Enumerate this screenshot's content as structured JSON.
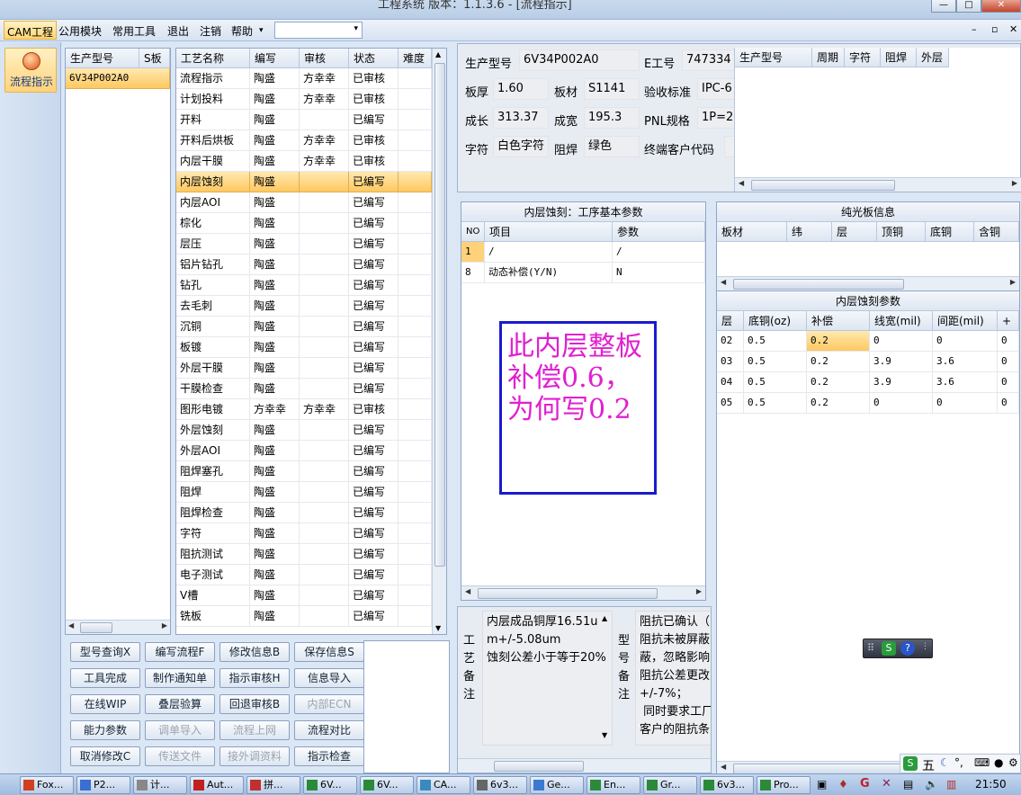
{
  "window": {
    "title": "工程系统   版本：1.1.3.6 - [流程指示]"
  },
  "menu": {
    "items": [
      "CAM工程",
      "公用模块",
      "常用工具",
      "退出",
      "注销",
      "帮助"
    ],
    "combo_value": ""
  },
  "left_nav": {
    "label": "流程指示"
  },
  "model_list": {
    "headers": [
      "生产型号",
      "S板"
    ],
    "rows": [
      [
        "6V34P002A0",
        ""
      ]
    ]
  },
  "process_table": {
    "headers": [
      "工艺名称",
      "编写",
      "审核",
      "状态",
      "难度"
    ],
    "rows": [
      [
        "流程指示",
        "陶盛",
        "方幸幸",
        "已审核",
        ""
      ],
      [
        "计划投料",
        "陶盛",
        "方幸幸",
        "已审核",
        ""
      ],
      [
        "开料",
        "陶盛",
        "",
        "已编写",
        ""
      ],
      [
        "开料后烘板",
        "陶盛",
        "方幸幸",
        "已审核",
        ""
      ],
      [
        "内层干膜",
        "陶盛",
        "方幸幸",
        "已审核",
        ""
      ],
      [
        "内层蚀刻",
        "陶盛",
        "",
        "已编写",
        ""
      ],
      [
        "内层AOI",
        "陶盛",
        "",
        "已编写",
        ""
      ],
      [
        "棕化",
        "陶盛",
        "",
        "已编写",
        ""
      ],
      [
        "层压",
        "陶盛",
        "",
        "已编写",
        ""
      ],
      [
        "铝片钻孔",
        "陶盛",
        "",
        "已编写",
        ""
      ],
      [
        "钻孔",
        "陶盛",
        "",
        "已编写",
        ""
      ],
      [
        "去毛刺",
        "陶盛",
        "",
        "已编写",
        ""
      ],
      [
        "沉铜",
        "陶盛",
        "",
        "已编写",
        ""
      ],
      [
        "板镀",
        "陶盛",
        "",
        "已编写",
        ""
      ],
      [
        "外层干膜",
        "陶盛",
        "",
        "已编写",
        ""
      ],
      [
        "干膜检查",
        "陶盛",
        "",
        "已编写",
        ""
      ],
      [
        "图形电镀",
        "方幸幸",
        "方幸幸",
        "已审核",
        ""
      ],
      [
        "外层蚀刻",
        "陶盛",
        "",
        "已编写",
        ""
      ],
      [
        "外层AOI",
        "陶盛",
        "",
        "已编写",
        ""
      ],
      [
        "阻焊塞孔",
        "陶盛",
        "",
        "已编写",
        ""
      ],
      [
        "阻焊",
        "陶盛",
        "",
        "已编写",
        ""
      ],
      [
        "阻焊检查",
        "陶盛",
        "",
        "已编写",
        ""
      ],
      [
        "字符",
        "陶盛",
        "",
        "已编写",
        ""
      ],
      [
        "阻抗测试",
        "陶盛",
        "",
        "已编写",
        ""
      ],
      [
        "电子测试",
        "陶盛",
        "",
        "已编写",
        ""
      ],
      [
        "V槽",
        "陶盛",
        "",
        "已编写",
        ""
      ],
      [
        "铣板",
        "陶盛",
        "",
        "已编写",
        ""
      ]
    ],
    "selected_index": 5
  },
  "buttons": [
    [
      "型号查询X",
      "编写流程F",
      "修改信息B",
      "保存信息S"
    ],
    [
      "工具完成",
      "制作通知单",
      "指示审核H",
      "信息导入"
    ],
    [
      "在线WIP",
      "叠层验算",
      "回退审核B",
      "内部ECN"
    ],
    [
      "能力参数",
      "调单导入",
      "流程上网",
      "流程对比"
    ],
    [
      "取消修改C",
      "传送文件",
      "接外调资料",
      "指示检查"
    ]
  ],
  "disabled_buttons": [
    "内部ECN",
    "调单导入",
    "流程上网",
    "传送文件",
    "接外调资料"
  ],
  "info": {
    "model_label": "生产型号",
    "model_value": "6V34P002A0",
    "eno_label": "E工号",
    "eno_value": "747334",
    "thick_label": "板厚",
    "thick_value": "1.60",
    "mat_label": "板材",
    "mat_value": "S1141",
    "std_label": "验收标准",
    "std_value": "IPC-6",
    "len_label": "成长",
    "len_value": "313.37",
    "wid_label": "成宽",
    "wid_value": "195.3",
    "pnl_label": "PNL规格",
    "pnl_value": "1P=2",
    "char_label": "字符",
    "char_value": "白色字符",
    "mask_label": "阻焊",
    "mask_value": "绿色",
    "cust_label": "终端客户代码",
    "cust_value": ""
  },
  "right_top_table": {
    "headers": [
      "生产型号",
      "周期",
      "字符",
      "阻焊",
      "外层"
    ]
  },
  "param_panel": {
    "title": "内层蚀刻：工序基本参数",
    "headers": [
      "NO",
      "项目",
      "参数"
    ],
    "rows": [
      [
        "1",
        "/",
        "/"
      ],
      [
        "8",
        "动态补偿(Y/N)",
        "N"
      ]
    ]
  },
  "annotation": {
    "text": "此内层整板补偿0.6，为何写0.2"
  },
  "light_board": {
    "title": "纯光板信息",
    "headers": [
      "板材",
      "纬",
      "层",
      "顶铜",
      "底铜",
      "含铜"
    ]
  },
  "etch_params": {
    "title": "内层蚀刻参数",
    "headers": [
      "层",
      "底铜(oz)",
      "补偿",
      "线宽(mil)",
      "间距(mil)",
      "+"
    ],
    "rows": [
      [
        "02",
        "0.5",
        "0.2",
        "0",
        "0",
        "0"
      ],
      [
        "03",
        "0.5",
        "0.2",
        "3.9",
        "3.6",
        "0"
      ],
      [
        "04",
        "0.5",
        "0.2",
        "3.9",
        "3.6",
        "0"
      ],
      [
        "05",
        "0.5",
        "0.2",
        "0",
        "0",
        "0"
      ]
    ]
  },
  "notes": {
    "process_label": "工艺备注",
    "process_text": "内层成品铜厚16.51um+/-5.08um\n蚀刻公差小于等于20%",
    "model_label": "型号备注",
    "model_text": "阻抗已确认（\n阻抗未被屏蔽\n蔽，忽略影响\n阻抗公差更改\n+/-7%；\n 同时要求工厂\n客户的阻抗条"
  },
  "taskbar": {
    "items": [
      "Fox...",
      "P2...",
      "计...",
      "Aut...",
      "拼...",
      "6V...",
      "6V...",
      "CA...",
      "6v3...",
      "Ge...",
      "En...",
      "Gr...",
      "6v3...",
      "Pro..."
    ],
    "clock": "21:50",
    "ime": "五"
  },
  "colors": {
    "accent": "#ffc861",
    "annotation_text": "#e020d0",
    "annotation_border": "#1a1ad0"
  }
}
